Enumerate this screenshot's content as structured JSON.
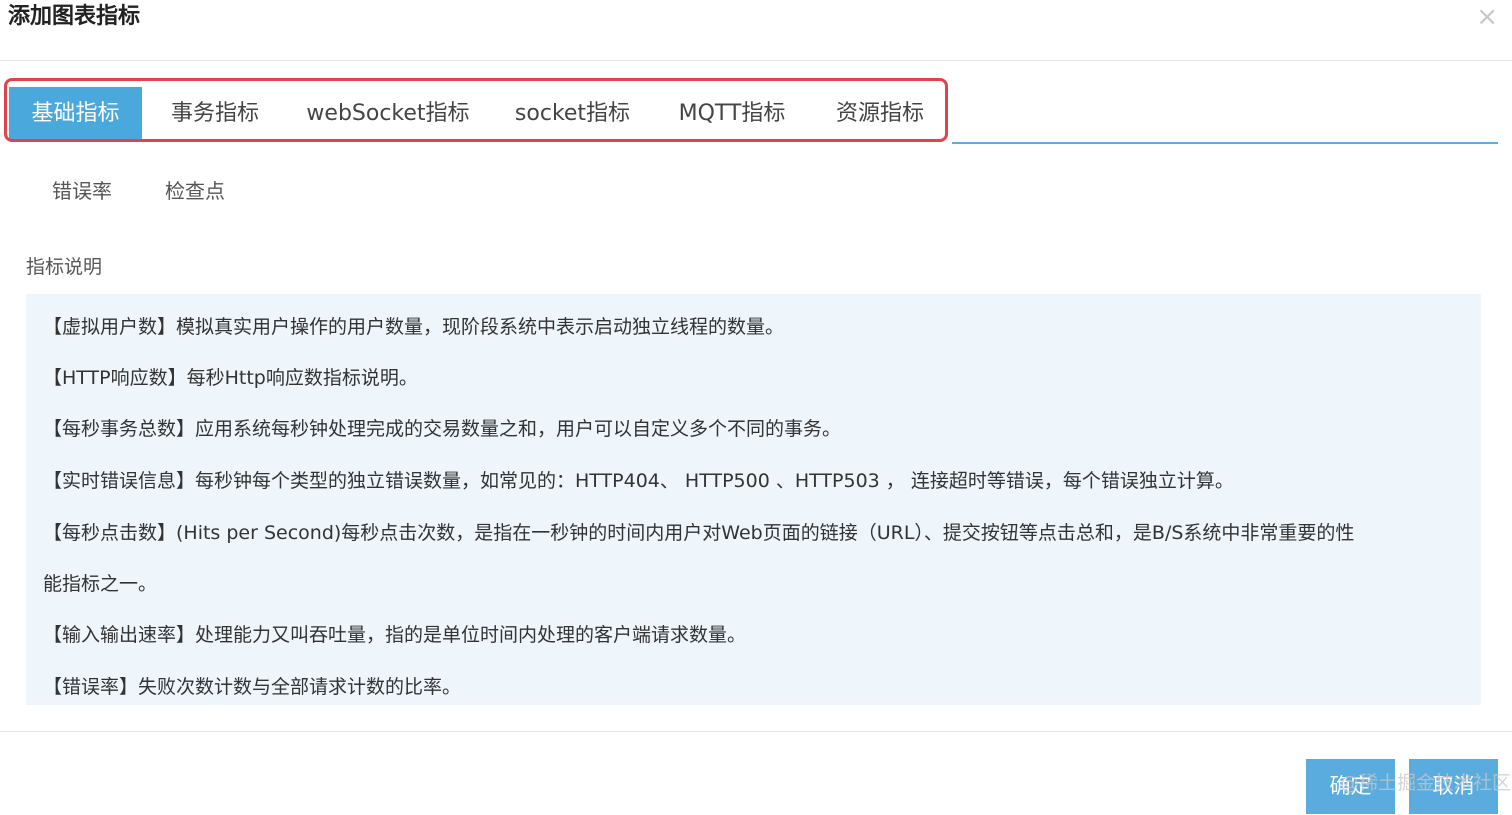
{
  "dialog": {
    "title": "添加图表指标",
    "close_glyph": "×"
  },
  "tabs": [
    {
      "label": "基础指标",
      "active": true
    },
    {
      "label": "事务指标",
      "active": false
    },
    {
      "label": "webSocket指标",
      "active": false
    },
    {
      "label": "socket指标",
      "active": false
    },
    {
      "label": "MQTT指标",
      "active": false
    },
    {
      "label": "资源指标",
      "active": false
    }
  ],
  "subtabs": [
    {
      "label": "错误率"
    },
    {
      "label": "检查点"
    }
  ],
  "description": {
    "label": "指标说明",
    "lines": [
      "【虚拟用户数】模拟真实用户操作的用户数量，现阶段系统中表示启动独立线程的数量。",
      "【HTTP响应数】每秒Http响应数指标说明。",
      "【每秒事务总数】应用系统每秒钟处理完成的交易数量之和，用户可以自定义多个不同的事务。",
      "【实时错误信息】每秒钟每个类型的独立错误数量，如常见的：HTTP404、 HTTP500 、HTTP503 ， 连接超时等错误，每个错误独立计算。",
      "【每秒点击数】(Hits per Second)每秒点击次数，是指在一秒钟的时间内用户对Web页面的链接（URL）、提交按钮等点击总和，是B/S系统中非常重要的性",
      "能指标之一。",
      "【输入输出速率】处理能力又叫吞吐量，指的是单位时间内处理的客户端请求数量。",
      "【错误率】失败次数计数与全部请求计数的比率。"
    ]
  },
  "footer": {
    "ok_label": "确定",
    "cancel_label": "取消",
    "watermark": "@稀土掘金技术社区"
  },
  "colors": {
    "accent": "#4ba8dc",
    "highlight_border": "#e0434b",
    "desc_background": "#eef5fb"
  }
}
